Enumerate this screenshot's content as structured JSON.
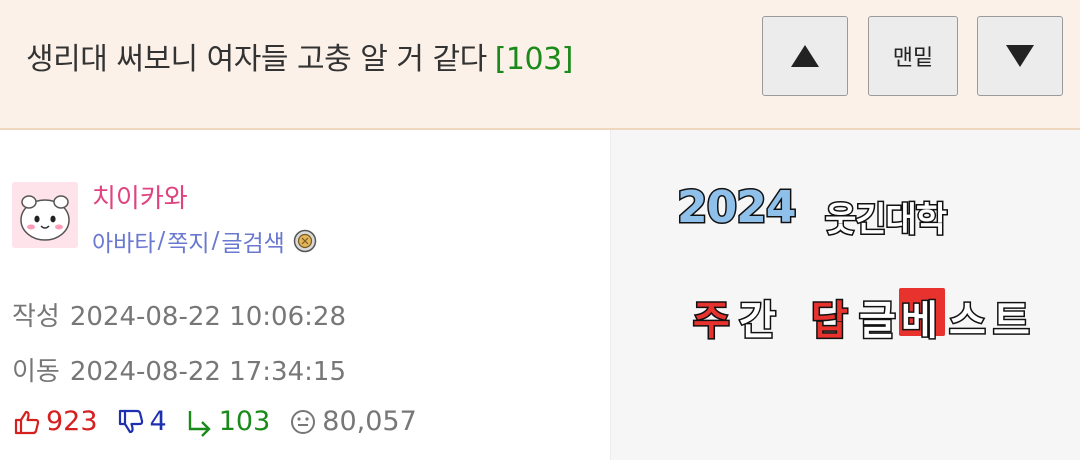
{
  "header": {
    "title": "생리대 써보니 여자들 고충 알 거 같다",
    "comment_count": "[103]",
    "buttons": {
      "up": "scroll-to-top",
      "bottom_label": "맨밑",
      "down": "scroll-to-bottom"
    }
  },
  "author": {
    "nickname": "치이카와",
    "links": [
      "아바타",
      "쪽지",
      "글검색"
    ],
    "link_separator": "/",
    "avatar_icon": "chiikawa-avatar-icon",
    "level_icon": "member-level-icon"
  },
  "meta": {
    "written_label": "작성",
    "written_at": "2024-08-22 10:06:28",
    "moved_label": "이동",
    "moved_at": "2024-08-22 17:34:15"
  },
  "stats": {
    "upvotes": "923",
    "downvotes": "4",
    "replies": "103",
    "views": "80,057"
  },
  "banner": {
    "year": "2024",
    "school": "웃긴대학",
    "line2": [
      "주",
      "간",
      "답",
      "글",
      "베",
      "스",
      "트"
    ]
  },
  "colors": {
    "header_bg": "#fbf1e8",
    "nickname": "#e0437f",
    "links": "#6a78cf",
    "upvote": "#d62020",
    "downvote": "#1e2fb0",
    "reply": "#1a8a1a",
    "banner_accent": "#e7322e",
    "banner_year": "#8ec0ea"
  }
}
